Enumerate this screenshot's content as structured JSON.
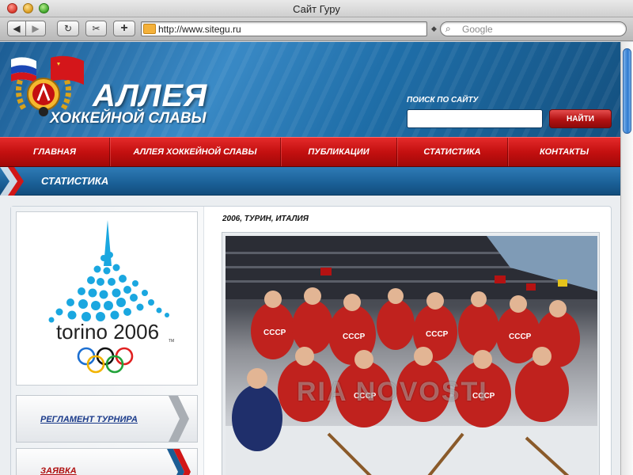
{
  "window": {
    "title": "Сайт Гуру"
  },
  "toolbar": {
    "back_glyph": "◀",
    "forward_glyph": "▶",
    "reload_glyph": "↻",
    "snip_glyph": "✂",
    "add_glyph": "+",
    "url": "http://www.sitegu.ru",
    "search_placeholder": "Google",
    "search_glyph": "⌕"
  },
  "site": {
    "logo_main": "АЛЛЕЯ",
    "logo_sub": "ХОККЕЙНОЙ СЛАВЫ",
    "search_label": "ПОИСК ПО САЙТУ",
    "search_button": "НАЙТИ",
    "search_value": ""
  },
  "nav": {
    "items": [
      {
        "label": "ГЛАВНАЯ"
      },
      {
        "label": "АЛЛЕЯ ХОККЕЙНОЙ СЛАВЫ"
      },
      {
        "label": "ПУБЛИКАЦИИ"
      },
      {
        "label": "СТАТИСТИКА"
      },
      {
        "label": "КОНТАКТЫ"
      }
    ]
  },
  "section": {
    "title": "СТАТИСТИКА"
  },
  "sidebar": {
    "olympic_logo_text": "torino 2006",
    "tm": "TM",
    "menu": [
      {
        "label": "РЕГЛАМЕНТ ТУРНИРА"
      },
      {
        "label": "ЗАЯВКА"
      }
    ]
  },
  "main": {
    "photo_caption": "2006, ТУРИН, ИТАЛИЯ",
    "photo_watermark": "RIA NOVOSTI"
  },
  "colors": {
    "nav_red": "#c41010",
    "header_blue": "#1f6ea8",
    "link_blue": "#1a3a8a",
    "olympic_blue": "#1aa7e0"
  }
}
